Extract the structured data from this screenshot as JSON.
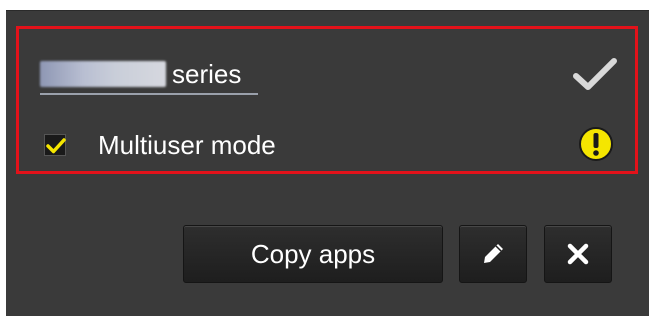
{
  "printer": {
    "name_suffix": "series",
    "name_prefix_icon": "blurred-model-name"
  },
  "status_icons": {
    "connected": "check-icon",
    "warning": "warning-icon"
  },
  "multiuser": {
    "label": "Multiuser mode",
    "checked": true
  },
  "actions": {
    "copy_label": "Copy apps",
    "edit_icon": "pencil-icon",
    "close_icon": "close-icon"
  },
  "colors": {
    "panel": "#3a3a3a",
    "highlight": "#e3121a",
    "checkbox_mark": "#f5e600",
    "warning": "#f5e600",
    "text": "#ffffff"
  }
}
